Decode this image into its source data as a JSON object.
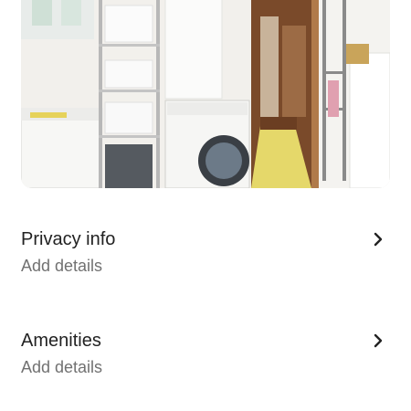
{
  "listing_photo": {
    "alt": "",
    "icon": "laundry-room-photo"
  },
  "sections": [
    {
      "title": "Privacy info",
      "subtitle": "Add details",
      "icon": "chevron-right-icon"
    },
    {
      "title": "Amenities",
      "subtitle": "Add details",
      "icon": "chevron-right-icon"
    }
  ]
}
